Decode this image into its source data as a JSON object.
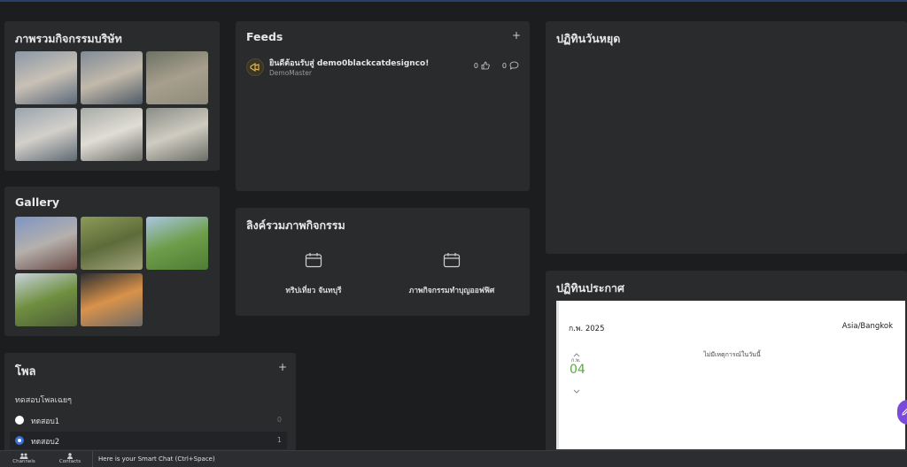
{
  "activities_card": {
    "title": "ภาพรวมกิจกรรมบริษัท",
    "photos": [
      {
        "colors": [
          "#8a97a6",
          "#c9c1b6",
          "#5c6a7a"
        ]
      },
      {
        "colors": [
          "#7f8b98",
          "#c2b9ab",
          "#4e5b66"
        ]
      },
      {
        "colors": [
          "#6d7264",
          "#a89f8e",
          "#8d8a7a"
        ]
      },
      {
        "colors": [
          "#9aa4ae",
          "#d3d0ca",
          "#5f6a74"
        ]
      },
      {
        "colors": [
          "#a7aba7",
          "#e0ddd4",
          "#6f706b"
        ]
      },
      {
        "colors": [
          "#8a8e88",
          "#cfcbc0",
          "#6a6e68"
        ]
      }
    ]
  },
  "gallery_card": {
    "title": "Gallery",
    "photos": [
      {
        "colors": [
          "#7e95c4",
          "#b5b0ac",
          "#6b4a46"
        ]
      },
      {
        "colors": [
          "#8d9a58",
          "#5d6b3a",
          "#a2a37c"
        ]
      },
      {
        "colors": [
          "#a9c6e3",
          "#6e9d4a",
          "#4f7c34"
        ]
      },
      {
        "colors": [
          "#c8d2dc",
          "#6f8f3f",
          "#4d5b3a"
        ]
      },
      {
        "colors": [
          "#2e3030",
          "#d9924a",
          "#6b6a68"
        ]
      }
    ]
  },
  "feeds_card": {
    "title": "Feeds",
    "add_label": "+",
    "item": {
      "text": "ยินดีต้อนรับสู่ demo0blackcatdesignco!",
      "author": "DemoMaster",
      "likes": "0",
      "comments": "0"
    }
  },
  "links_card": {
    "title": "ลิงค์รวมภาพกิจกรรม",
    "items": [
      {
        "label": "ทริปเที่ยว จันทบุรี"
      },
      {
        "label": "ภาพกิจกรรมทำบุญออฟฟิศ"
      }
    ]
  },
  "holiday_card": {
    "title": "ปฏิทินวันหยุด"
  },
  "announce_card": {
    "title": "ปฏิทินประกาศ",
    "month_label": "ก.พ. 2025",
    "timezone": "Asia/Bangkok",
    "day_month_abbr": "ก.พ.",
    "day_number": "04",
    "empty_message": "ไม่มีเหตุการณ์ในวันนี้",
    "accent_color": "#5aa846"
  },
  "poll_card": {
    "title": "โพล",
    "add_label": "+",
    "question": "ทดสอบโพลเฉยๆ",
    "options": [
      {
        "label": "ทดสอบ1",
        "count": "0",
        "selected": false
      },
      {
        "label": "ทดสอบ2",
        "count": "1",
        "selected": true
      }
    ]
  },
  "bottom_bar": {
    "channels_label": "Channels",
    "contacts_label": "Contacts",
    "chat_hint": "Here is your Smart Chat (Ctrl+Space)"
  },
  "colors": {
    "background": "#1c1d1f",
    "card": "#2a2b2d",
    "radio_selected": "#3b6fd8",
    "fab": "#7a4bd8"
  }
}
